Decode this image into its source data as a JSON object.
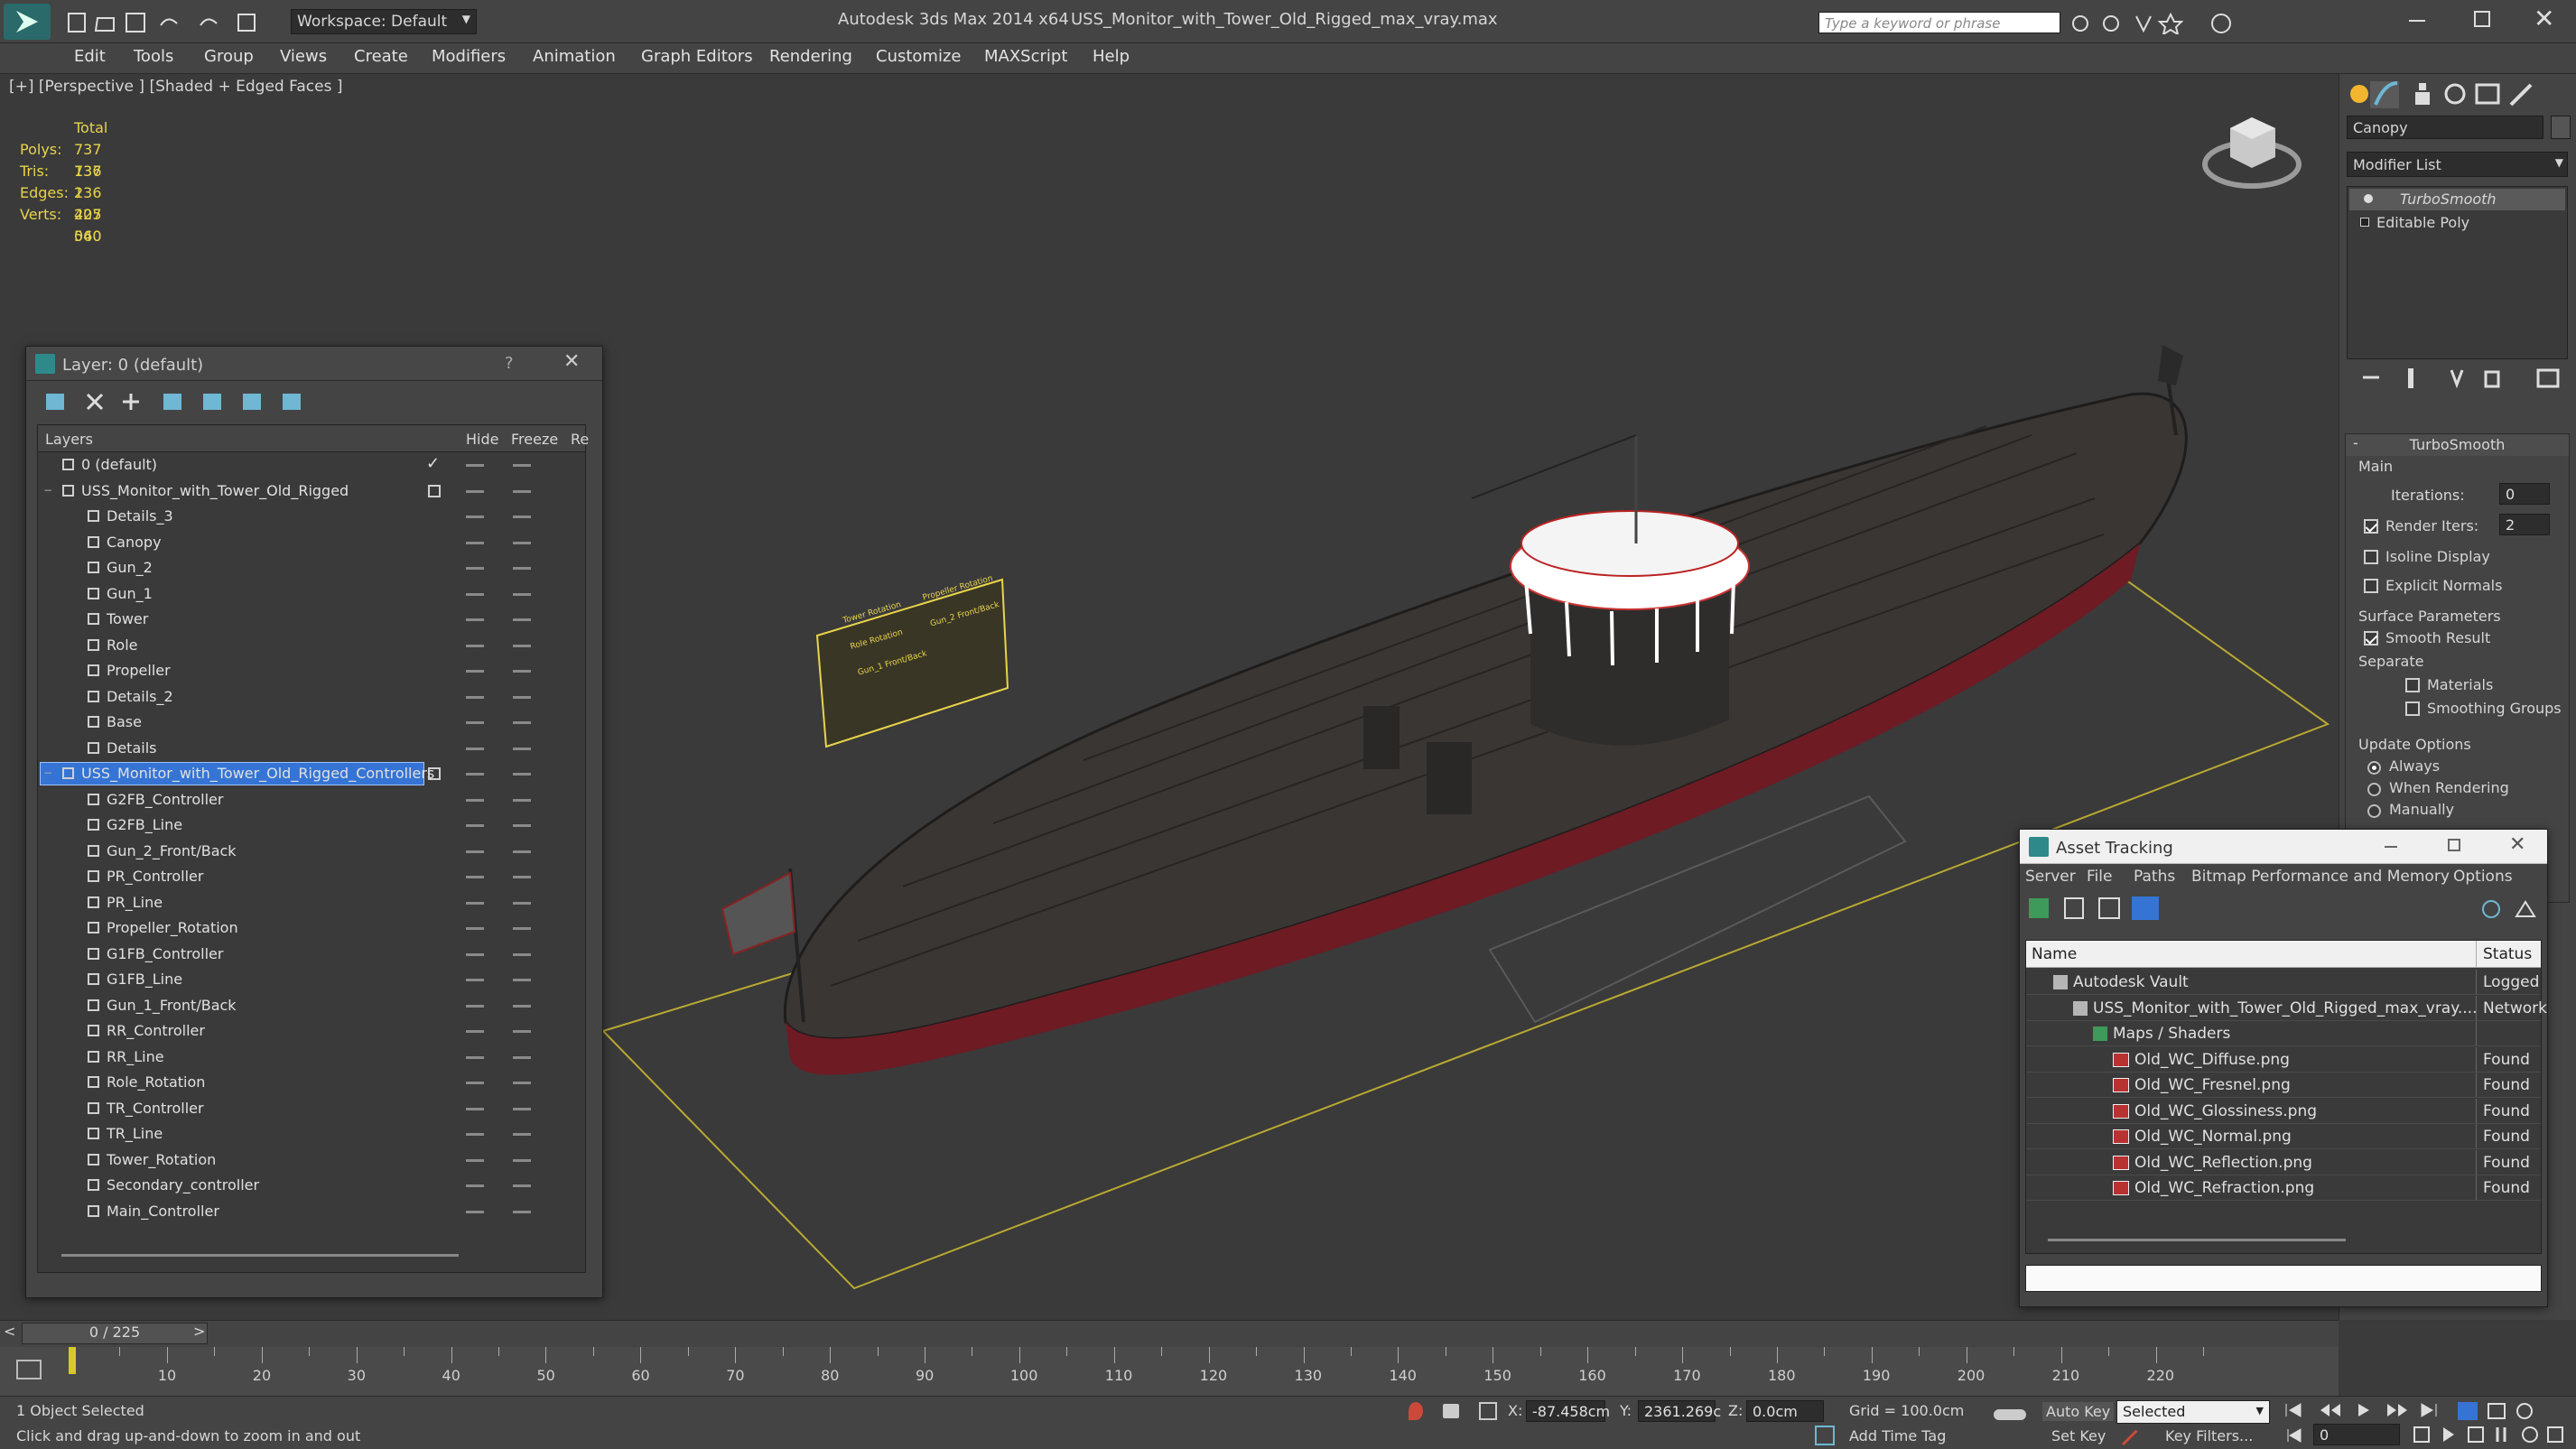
{
  "title": {
    "app": "Autodesk 3ds Max  2014 x64",
    "file": "USS_Monitor_with_Tower_Old_Rigged_max_vray.max",
    "workspace": "Workspace: Default",
    "search_placeholder": "Type a keyword or phrase"
  },
  "menu": [
    "Edit",
    "Tools",
    "Group",
    "Views",
    "Create",
    "Modifiers",
    "Animation",
    "Graph Editors",
    "Rendering",
    "Customize",
    "MAXScript",
    "Help"
  ],
  "viewport": {
    "label": "[+] [Perspective ] [Shaded + Edged Faces ]",
    "stats": {
      "header": "Total",
      "rows": [
        {
          "label": "Polys:",
          "value": "737 136"
        },
        {
          "label": "Tris:",
          "value": "737 136"
        },
        {
          "label": "Edges:",
          "value": "2 205 040"
        },
        {
          "label": "Verts:",
          "value": "427 560"
        }
      ]
    },
    "billboard": [
      "Tower Rotation",
      "Role Rotation",
      "Gun_1 Front/Back",
      "Propeller Rotation",
      "Gun_2 Front/Back"
    ]
  },
  "layer_window": {
    "title": "Layer: 0 (default)",
    "help": "?",
    "columns": {
      "layers": "Layers",
      "hide": "Hide",
      "freeze": "Freeze",
      "render": "Re"
    },
    "rows": [
      {
        "name": "0 (default)",
        "level": 0,
        "type": "layer",
        "current": true
      },
      {
        "name": "USS_Monitor_with_Tower_Old_Rigged",
        "level": 0,
        "type": "layer",
        "box": true
      },
      {
        "name": "Details_3",
        "level": 1
      },
      {
        "name": "Canopy",
        "level": 1
      },
      {
        "name": "Gun_2",
        "level": 1
      },
      {
        "name": "Gun_1",
        "level": 1
      },
      {
        "name": "Tower",
        "level": 1
      },
      {
        "name": "Role",
        "level": 1
      },
      {
        "name": "Propeller",
        "level": 1
      },
      {
        "name": "Details_2",
        "level": 1
      },
      {
        "name": "Base",
        "level": 1
      },
      {
        "name": "Details",
        "level": 1
      },
      {
        "name": "USS_Monitor_with_Tower_Old_Rigged_Controllers",
        "level": 0,
        "type": "layer",
        "box": true,
        "selected": true
      },
      {
        "name": "G2FB_Controller",
        "level": 1
      },
      {
        "name": "G2FB_Line",
        "level": 1
      },
      {
        "name": "Gun_2_Front/Back",
        "level": 1
      },
      {
        "name": "PR_Controller",
        "level": 1
      },
      {
        "name": "PR_Line",
        "level": 1
      },
      {
        "name": "Propeller_Rotation",
        "level": 1
      },
      {
        "name": "G1FB_Controller",
        "level": 1
      },
      {
        "name": "G1FB_Line",
        "level": 1
      },
      {
        "name": "Gun_1_Front/Back",
        "level": 1
      },
      {
        "name": "RR_Controller",
        "level": 1
      },
      {
        "name": "RR_Line",
        "level": 1
      },
      {
        "name": "Role_Rotation",
        "level": 1
      },
      {
        "name": "TR_Controller",
        "level": 1
      },
      {
        "name": "TR_Line",
        "level": 1
      },
      {
        "name": "Tower_Rotation",
        "level": 1
      },
      {
        "name": "Secondary_controller",
        "level": 1
      },
      {
        "name": "Main_Controller",
        "level": 1
      }
    ]
  },
  "command_panel": {
    "object_name": "Canopy",
    "modifier_list": "Modifier List",
    "stack": [
      "TurboSmooth",
      "Editable Poly"
    ],
    "rollout_title": "TurboSmooth",
    "main_label": "Main",
    "iterations_label": "Iterations:",
    "iterations_value": "0",
    "render_iters_label": "Render Iters:",
    "render_iters_value": "2",
    "isoline_label": "Isoline Display",
    "explicit_normals_label": "Explicit Normals",
    "surface_params_label": "Surface Parameters",
    "smooth_result_label": "Smooth Result",
    "separate_label": "Separate",
    "materials_label": "Materials",
    "smoothing_groups_label": "Smoothing Groups",
    "update_options_label": "Update Options",
    "always_label": "Always",
    "when_rendering_label": "When Rendering",
    "manually_label": "Manually"
  },
  "asset_window": {
    "title": "Asset Tracking",
    "menu": [
      "Server",
      "File",
      "Paths",
      "Bitmap Performance and Memory",
      "Options"
    ],
    "columns": {
      "name": "Name",
      "status": "Status"
    },
    "rows": [
      {
        "name": "Autodesk Vault",
        "status": "Logged",
        "level": 1,
        "icon": "vault"
      },
      {
        "name": "USS_Monitor_with_Tower_Old_Rigged_max_vray....",
        "status": "Network",
        "level": 2,
        "icon": "file"
      },
      {
        "name": "Maps / Shaders",
        "status": "",
        "level": 3,
        "icon": "folder"
      },
      {
        "name": "Old_WC_Diffuse.png",
        "status": "Found",
        "level": 4,
        "icon": "png"
      },
      {
        "name": "Old_WC_Fresnel.png",
        "status": "Found",
        "level": 4,
        "icon": "png"
      },
      {
        "name": "Old_WC_Glossiness.png",
        "status": "Found",
        "level": 4,
        "icon": "png"
      },
      {
        "name": "Old_WC_Normal.png",
        "status": "Found",
        "level": 4,
        "icon": "png"
      },
      {
        "name": "Old_WC_Reflection.png",
        "status": "Found",
        "level": 4,
        "icon": "png"
      },
      {
        "name": "Old_WC_Refraction.png",
        "status": "Found",
        "level": 4,
        "icon": "png"
      }
    ]
  },
  "timeline": {
    "frame": "0 / 225",
    "ticks": [
      "10",
      "20",
      "30",
      "40",
      "50",
      "60",
      "70",
      "80",
      "90",
      "100",
      "110",
      "120",
      "130",
      "140",
      "150",
      "160",
      "170",
      "180",
      "190",
      "200",
      "210",
      "220"
    ]
  },
  "status": {
    "selection": "1 Object Selected",
    "prompt": "Click and drag up-and-down to zoom in and out",
    "x_label": "X:",
    "x_value": "-87.458cm",
    "y_label": "Y:",
    "y_value": "2361.269c",
    "z_label": "Z:",
    "z_value": "0.0cm",
    "grid": "Grid = 100.0cm",
    "add_time_tag": "Add Time Tag",
    "auto_key": "Auto Key",
    "selected_dropdown": "Selected",
    "set_key": "Set Key",
    "key_filters": "Key Filters...",
    "frame_value": "0"
  },
  "colors": {
    "accent": "#3574d4",
    "stats_yellow": "#e8d44a",
    "hull_red": "#7a1a22"
  }
}
